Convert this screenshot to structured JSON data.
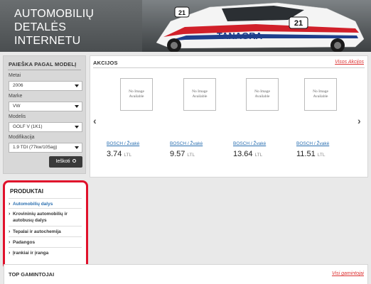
{
  "header": {
    "title_line1": "AUTOMOBILIŲ DETALĖS",
    "title_line2": "INTERNETU",
    "car_brand": "TANAGRA",
    "car_number": "21"
  },
  "search": {
    "title": "PAIEŠKA PAGAL MODELĮ",
    "fields": [
      {
        "label": "Metai",
        "value": "2006"
      },
      {
        "label": "Marke",
        "value": "VW"
      },
      {
        "label": "Modelis",
        "value": "GOLF V (1K1)"
      },
      {
        "label": "Modifikacija",
        "value": "1.9 TDI (77kw/105ag)"
      }
    ],
    "button_label": "Ieškoti"
  },
  "products": {
    "title": "PRODUKTAI",
    "items": [
      {
        "label": "Automobilių dalys"
      },
      {
        "label": "Krovininių automobilių ir autobusų dalys"
      },
      {
        "label": "Tepalai ir autochemija"
      },
      {
        "label": "Padangos"
      },
      {
        "label": "Įrankiai ir įranga"
      }
    ]
  },
  "deals": {
    "title": "AKCIJOS",
    "all_link": "Visos Akcijos",
    "noimage_line1": "No Image",
    "noimage_line2": "Available",
    "items": [
      {
        "name": "BOSCH / Žvakė",
        "price": "3.74",
        "currency": "LTL"
      },
      {
        "name": "BOSCH / Žvakė",
        "price": "9.57",
        "currency": "LTL"
      },
      {
        "name": "BOSCH / Žvakė",
        "price": "13.64",
        "currency": "LTL"
      },
      {
        "name": "BOSCH / Žvakė",
        "price": "11.51",
        "currency": "LTL"
      }
    ]
  },
  "makers": {
    "title": "TOP GAMINTOJAI",
    "all_link": "Visi gamintojai"
  },
  "colors": {
    "header_bg": "#555a5c",
    "highlight_border": "#e0112b",
    "link_blue": "#2a6fb0",
    "link_red": "#d33"
  }
}
